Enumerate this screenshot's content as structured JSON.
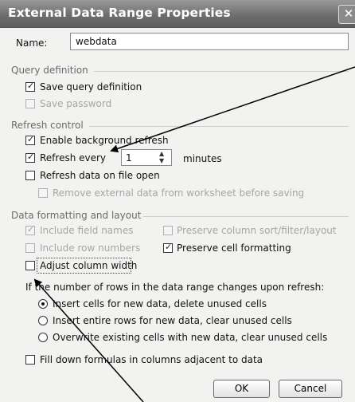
{
  "window": {
    "title": "External Data Range Properties",
    "close_label": "✕"
  },
  "name_field": {
    "label": "Name:",
    "value": "webdata"
  },
  "query_definition": {
    "heading": "Query definition",
    "save_query": {
      "label": "Save query definition",
      "checked": true
    },
    "save_password": {
      "label": "Save password",
      "checked": false,
      "disabled": true
    }
  },
  "refresh_control": {
    "heading": "Refresh control",
    "background_refresh": {
      "label": "Enable background refresh",
      "checked": true
    },
    "refresh_every": {
      "label": "Refresh every",
      "checked": true,
      "value": "1",
      "unit": "minutes"
    },
    "refresh_on_open": {
      "label": "Refresh data on file open",
      "checked": false
    },
    "remove_external": {
      "label": "Remove external data from worksheet before saving",
      "checked": false,
      "disabled": true
    }
  },
  "formatting": {
    "heading": "Data formatting and layout",
    "include_field_names": {
      "label": "Include field names",
      "checked": true,
      "disabled": true
    },
    "include_row_numbers": {
      "label": "Include row numbers",
      "checked": false,
      "disabled": true
    },
    "adjust_column_width": {
      "label": "Adjust column width",
      "checked": false
    },
    "preserve_sort": {
      "label": "Preserve column sort/filter/layout",
      "checked": false,
      "disabled": true
    },
    "preserve_cell_formatting": {
      "label": "Preserve cell formatting",
      "checked": true
    }
  },
  "row_change": {
    "prompt": "If the number of rows in the data range changes upon refresh:",
    "options": [
      {
        "label": "Insert cells for new data, delete unused cells",
        "selected": true
      },
      {
        "label": "Insert entire rows for new data, clear unused cells",
        "selected": false
      },
      {
        "label": "Overwrite existing cells with new data, clear unused cells",
        "selected": false
      }
    ]
  },
  "fill_down": {
    "label": "Fill down formulas in columns adjacent to data",
    "checked": false
  },
  "buttons": {
    "ok": "OK",
    "cancel": "Cancel"
  },
  "icons": {
    "check": "check-icon",
    "spin_up": "spin-up-icon",
    "spin_down": "spin-down-icon",
    "close": "close-icon"
  }
}
